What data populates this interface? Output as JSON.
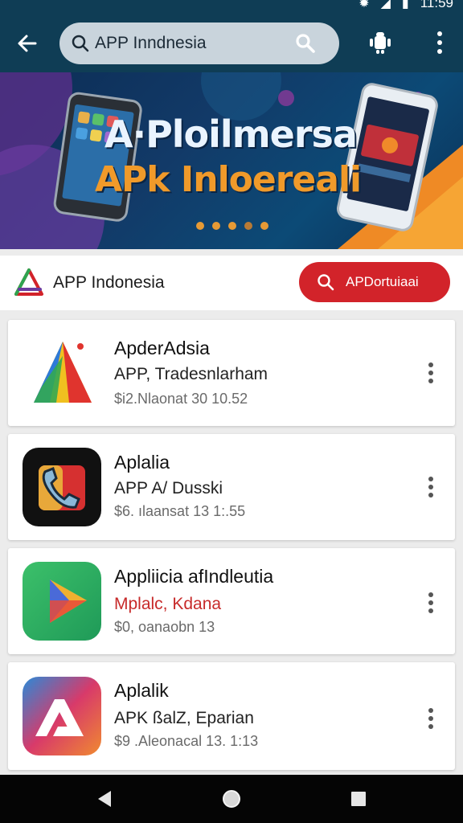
{
  "status_bar": {
    "time": "11:59"
  },
  "app_bar": {
    "search_value": "APP Inndnesia"
  },
  "banner": {
    "headline": "A·Ploilmersa",
    "subheadline": "APk Inloereali"
  },
  "brand": {
    "name": "APP Indonesia",
    "button_label": "APDortuiaai"
  },
  "apps": [
    {
      "title": "ApderAdsia",
      "subtitle": "APP, Tradesnlarham",
      "meta": "$i2.Nlaonat 30 10.52"
    },
    {
      "title": "Aplalia",
      "subtitle": "APP A/ Dusski",
      "meta": "$6. ılaansat 13 1:.55"
    },
    {
      "title": "Appliicia afIndleutia",
      "subtitle": "Mplalc, Kdana",
      "meta": "$0, oanaobn 13"
    },
    {
      "title": "Aplalik",
      "subtitle": "APK ßalZ, Eparian",
      "meta": "$9 .Aleonacal 13. 1:13"
    }
  ],
  "colors": {
    "app_bar": "#0f3d55",
    "accent_red": "#d2232a",
    "banner_orange": "#f09a2a"
  },
  "icons": [
    "back-arrow-icon",
    "search-icon",
    "android-icon",
    "more-vert-icon",
    "back-triangle-icon",
    "home-circle-icon",
    "recents-square-icon"
  ]
}
